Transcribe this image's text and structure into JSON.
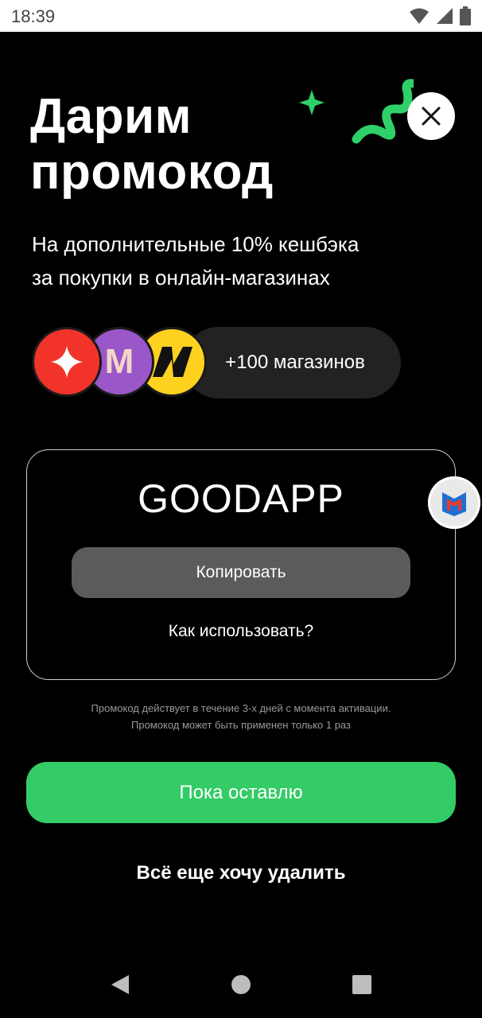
{
  "status_bar": {
    "time": "18:39"
  },
  "hero": {
    "title_line1": "Дарим",
    "title_line2": "промокод",
    "subtitle_line1": "На дополнительные 10% кешбэка",
    "subtitle_line2": "за покупки в онлайн-магазинах"
  },
  "stores": {
    "items": [
      {
        "icon": "yandex-market-star-icon",
        "color": "#f2332a"
      },
      {
        "icon": "megamarket-m-icon",
        "color": "#9a57c9",
        "letter": "M"
      },
      {
        "icon": "yandex-n-icon",
        "color": "#ffd21f"
      }
    ],
    "more_label": "+100 магазинов"
  },
  "promo": {
    "code": "GOODAPP",
    "copy_label": "Копировать",
    "how_label": "Как использовать?"
  },
  "note": {
    "line1": "Промокод действует в течение 3-х дней с момента активации.",
    "line2": "Промокод может быть применен только 1 раз"
  },
  "actions": {
    "keep_label": "Пока оставлю",
    "delete_label": "Всё еще хочу удалить"
  },
  "colors": {
    "accent_green": "#33cc66",
    "background": "#000000"
  }
}
